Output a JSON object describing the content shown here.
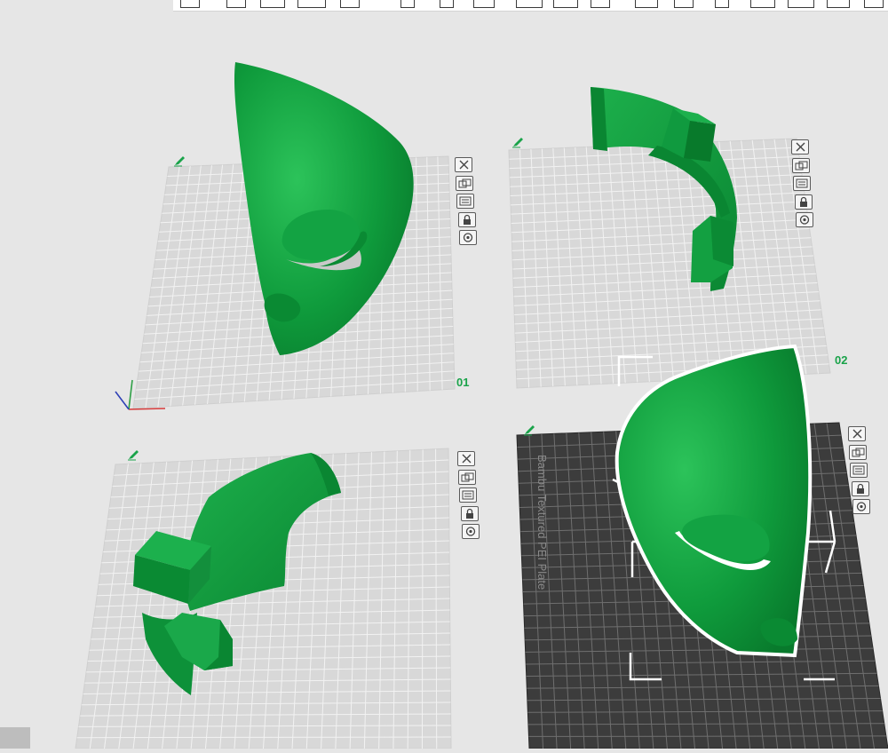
{
  "plates": [
    {
      "number": "01"
    },
    {
      "number": "02"
    },
    {
      "number": ""
    },
    {
      "number": "",
      "name": "Bambu Textured PEI Plate",
      "active": true
    }
  ],
  "plate_buttons": [
    "close-icon",
    "arrange-icon",
    "orient-icon",
    "lock-icon",
    "settings-icon"
  ],
  "colors": {
    "background": "#e6e6e6",
    "plate": "#d8d8d8",
    "plate_grid": "#f2f2f2",
    "active_plate": "#3c3c3c",
    "model_green": "#0f9b3c",
    "plate_number": "#1aa34a",
    "selection_outline": "#ffffff"
  }
}
